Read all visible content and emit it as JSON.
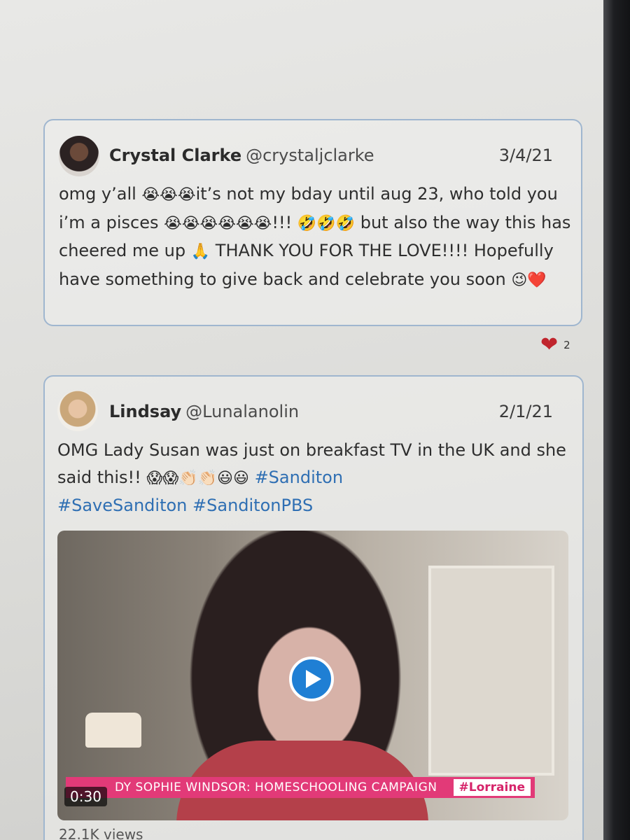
{
  "tweets": [
    {
      "display_name": "Crystal Clarke",
      "handle": "@crystaljclarke",
      "date": "3/4/21",
      "text_parts": {
        "p1": "omg y’all ",
        "e1": "😭😭😭",
        "p2": "it’s not my bday until aug 23, who told you i’m a pisces ",
        "e2": "😭😭😭😭😭😭",
        "p3": "!!! ",
        "e3": "🤣🤣🤣",
        "p4": " but also the way this has cheered me up ",
        "e4": "🙏",
        "p5": " THANK YOU FOR THE LOVE!!!! Hopefully have something to give back and celebrate you soon ",
        "e5": "😉❤️"
      },
      "likes": "2"
    },
    {
      "display_name": "Lindsay",
      "handle": "@Lunalanolin",
      "date": "2/1/21",
      "text_parts": {
        "p1": "OMG Lady Susan was just on breakfast TV in the UK and she said this!! ",
        "e1": "😱😱👏🏻👏🏻😃😃",
        "h1": " #Sanditon",
        "h2": "#SaveSanditon",
        "h3": " #SanditonPBS"
      },
      "video": {
        "banner": "DY SOPHIE WINDSOR: HOMESCHOOLING CAMPAIGN",
        "tag": "#Lorraine",
        "duration": "0:30"
      },
      "views": "22.1K views"
    }
  ]
}
